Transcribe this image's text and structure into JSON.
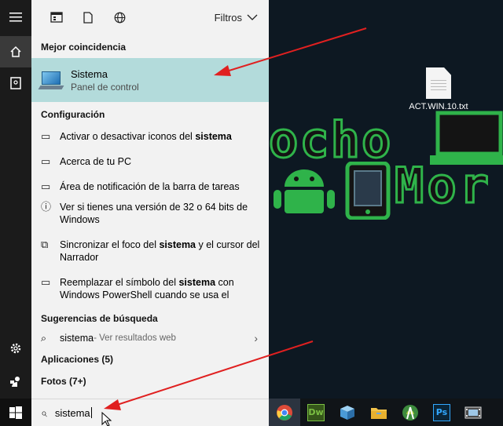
{
  "desktop": {
    "file_name": "ACT.WIN.10.txt",
    "logo_top": "ocho",
    "logo_bottom": "Mor"
  },
  "rail": {
    "items": [
      {
        "icon": "hamburger-menu-icon"
      },
      {
        "icon": "home-icon"
      },
      {
        "icon": "notebook-icon"
      },
      {
        "icon": "settings-gear-icon"
      },
      {
        "icon": "feedback-person-icon"
      }
    ]
  },
  "panel": {
    "filters_label": "Filtros",
    "best_match_heading": "Mejor coincidencia",
    "best_match": {
      "title": "Sistema",
      "subtitle": "Panel de control"
    },
    "config_heading": "Configuración",
    "config_items": [
      {
        "pre": "Activar o desactivar iconos del ",
        "bold": "sistema",
        "post": ""
      },
      {
        "pre": "Acerca de tu PC",
        "bold": "",
        "post": ""
      },
      {
        "pre": "Área de notificación de la barra de tareas",
        "bold": "",
        "post": ""
      },
      {
        "pre": "Ver si tienes una versión de 32 o 64 bits de Windows",
        "bold": "",
        "post": ""
      },
      {
        "pre": "Sincronizar el foco del ",
        "bold": "sistema",
        "post": " y el cursor del Narrador"
      },
      {
        "pre": "Reemplazar el símbolo del ",
        "bold": "sistema",
        "post": " con Windows PowerShell cuando se usa el"
      }
    ],
    "suggestions_heading": "Sugerencias de búsqueda",
    "suggestion": {
      "term": "sistema",
      "hint": " - Ver resultados web"
    },
    "apps_heading": "Aplicaciones (5)",
    "photos_heading": "Fotos (7+)"
  },
  "search": {
    "value": "sistema"
  },
  "taskbar": {
    "apps": [
      {
        "name": "chrome",
        "label": ""
      },
      {
        "name": "dreamweaver",
        "label": "Dw",
        "color": "#4f7a1e"
      },
      {
        "name": "3d-box",
        "label": ""
      },
      {
        "name": "file-explorer",
        "label": ""
      },
      {
        "name": "android-studio",
        "label": ""
      },
      {
        "name": "photoshop",
        "label": "Ps",
        "color": "#1d5a8a"
      },
      {
        "name": "media-player",
        "label": ""
      }
    ]
  },
  "colors": {
    "accent": "#e02020",
    "logo_green": "#2fb34a",
    "highlight": "#b3dbdb"
  }
}
